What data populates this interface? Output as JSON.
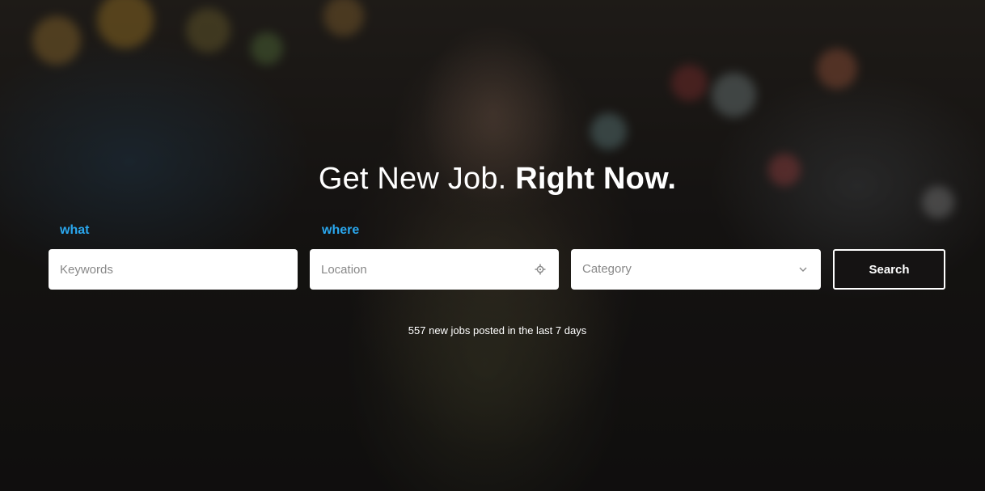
{
  "hero": {
    "headline_light": "Get New Job.",
    "headline_bold": "Right Now.",
    "stats_text": "557 new jobs posted in the last 7 days"
  },
  "search": {
    "what_label": "what",
    "where_label": "where",
    "keywords_placeholder": "Keywords",
    "location_placeholder": "Location",
    "category_selected": "Category",
    "search_button": "Search"
  },
  "colors": {
    "label_accent": "#2aa7ee",
    "button_bg": "#151313",
    "text_white": "#ffffff"
  },
  "icons": {
    "location": "crosshair-icon",
    "category": "chevron-down-icon"
  }
}
